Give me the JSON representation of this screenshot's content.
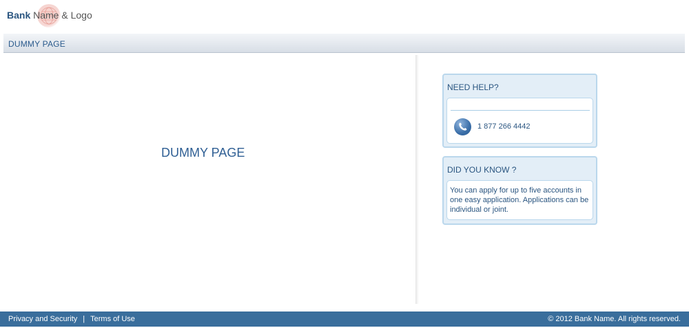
{
  "header": {
    "logo_bank": "Bank",
    "logo_rest": " Name & Logo"
  },
  "titlebar": {
    "title": "DUMMY PAGE"
  },
  "main": {
    "heading": "DUMMY PAGE"
  },
  "sidebar": {
    "help": {
      "heading": "NEED HELP?",
      "phone": "1 877 266 4442",
      "icon": "phone-icon"
    },
    "know": {
      "heading": "DID YOU KNOW ?",
      "text": "You can apply for up to five accounts in one easy application. Applications can be individual or joint."
    }
  },
  "footer": {
    "privacy": "Privacy and Security",
    "separator": "|",
    "terms": "Terms of Use",
    "copyright": "© 2012 Bank Name. All rights reserved."
  },
  "colors": {
    "brand_blue": "#2a5580",
    "footer_bg": "#3a6e9c",
    "box_bg": "#e3eef7",
    "box_border": "#bad7ec"
  }
}
